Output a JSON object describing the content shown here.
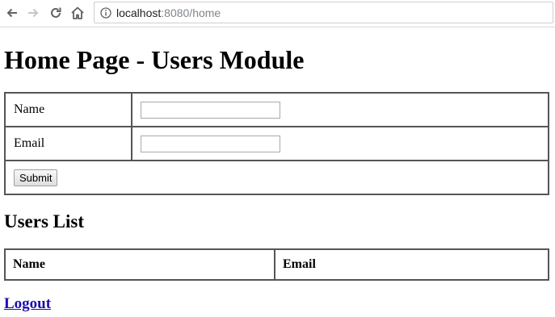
{
  "browser": {
    "url_host": "localhost",
    "url_rest": ":8080/home",
    "icons": [
      "back-arrow-icon",
      "forward-arrow-icon",
      "reload-icon",
      "home-icon",
      "info-icon"
    ]
  },
  "page": {
    "title": "Home Page - Users Module"
  },
  "form": {
    "name_label": "Name",
    "name_value": "",
    "email_label": "Email",
    "email_value": "",
    "submit_label": "Submit"
  },
  "users_list": {
    "title": "Users List",
    "columns": [
      "Name",
      "Email"
    ]
  },
  "logout_label": "Logout",
  "colors": {
    "link": "#1a0dab",
    "border": "#555555"
  }
}
